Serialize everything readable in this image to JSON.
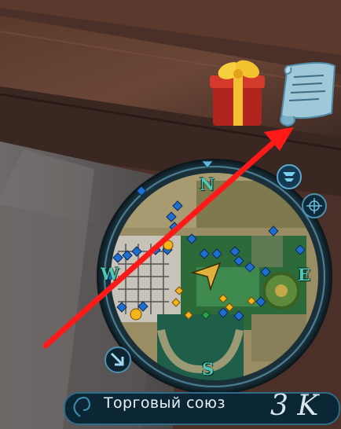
{
  "hud": {
    "zone_name": "Торговый союз",
    "zone_level": "3 K"
  },
  "minimap": {
    "compass": {
      "north": "N",
      "east": "E",
      "south": "S",
      "west": "W"
    }
  },
  "icons": {
    "gift": "gift-icon",
    "quest_scroll": "scroll-icon",
    "filter": "filter-icon",
    "target": "crosshair-icon",
    "zoom": "zoom-arrow-icon",
    "player": "player-arrow-icon",
    "pin": "map-pin-icon",
    "marker": "map-marker-icon"
  },
  "colors": {
    "annotation_arrow": "#ff1a1a",
    "compass_letter": "#4ec9b8",
    "marker_blue": "#1f6fd1",
    "marker_gold": "#f2b51c"
  }
}
